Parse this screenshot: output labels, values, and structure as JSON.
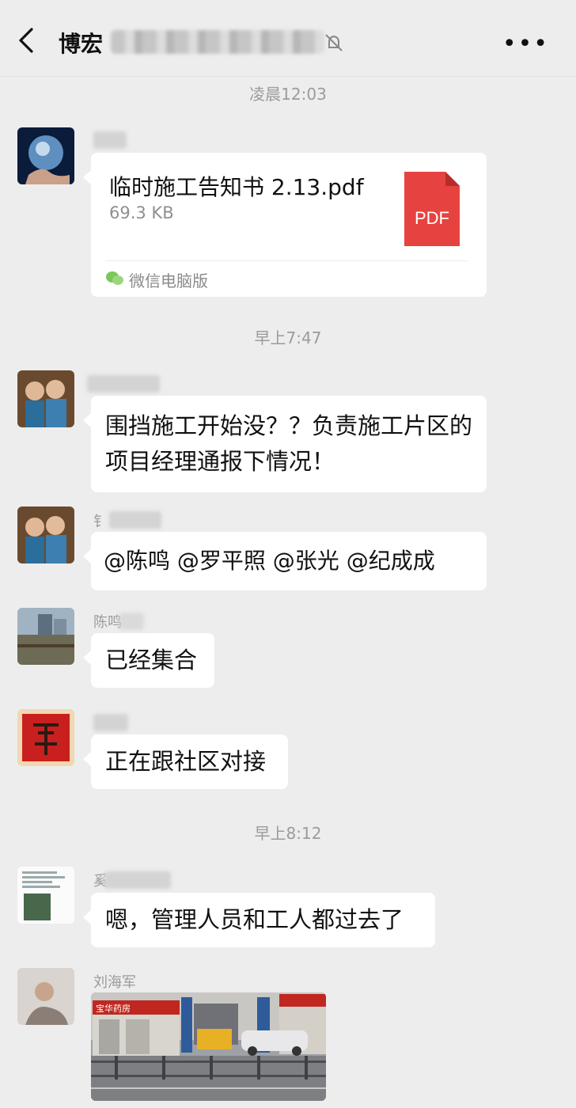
{
  "header": {
    "title": "博宏",
    "more_icon": "more-dots-icon",
    "back_icon": "chevron-left-icon",
    "mute_icon": "mute-bell-icon"
  },
  "chat": {
    "times": [
      "凌晨12:03",
      "早上7:47",
      "早上8:12"
    ],
    "messages": [
      {
        "type": "file",
        "sender": "",
        "file_name": "临时施工告知书 2.13.pdf",
        "file_size": "69.3 KB",
        "file_badge": "PDF",
        "source": "微信电脑版"
      },
      {
        "type": "text",
        "sender": "",
        "text": "围挡施工开始没？？负责施工片区的项目经理通报下情况！"
      },
      {
        "type": "text",
        "sender": "钅",
        "text": "@陈鸣  @罗平照  @张光  @纪成成"
      },
      {
        "type": "text",
        "sender": "陈鸣",
        "text": "已经集合"
      },
      {
        "type": "text",
        "sender": "",
        "text": "正在跟社区对接"
      },
      {
        "type": "text",
        "sender": "奚",
        "text": "嗯，管理人员和工人都过去了"
      },
      {
        "type": "image",
        "sender": "刘海军",
        "shop_sign_text": "宝华药房",
        "description": ""
      }
    ]
  }
}
